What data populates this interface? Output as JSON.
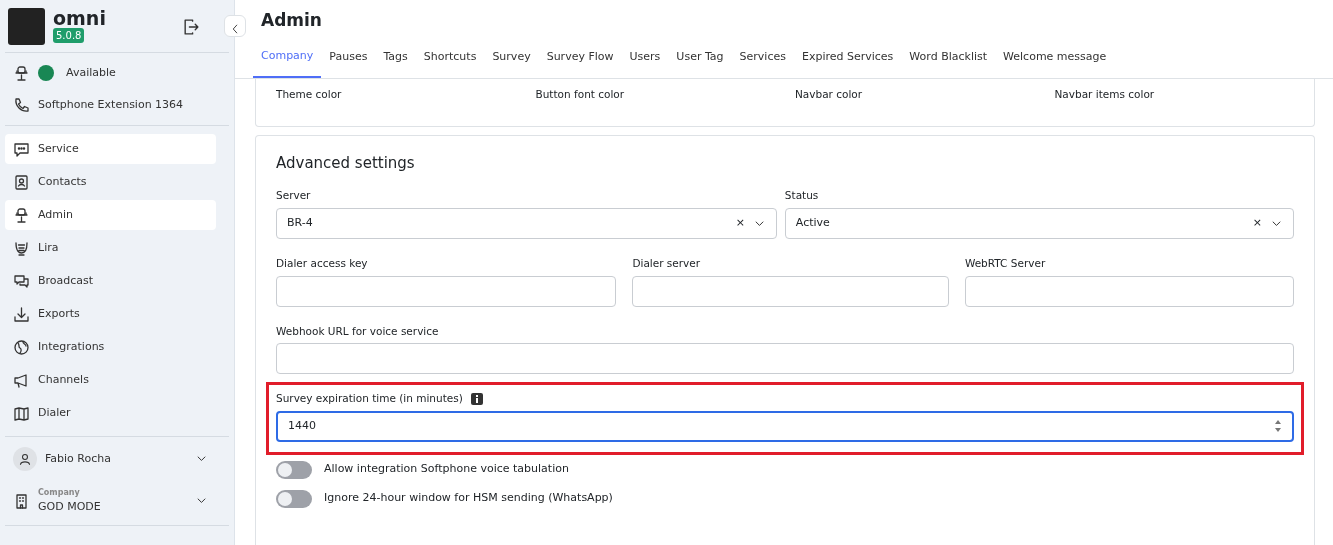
{
  "brand": {
    "name": "omni",
    "version": "5.0.8"
  },
  "status": {
    "label": "Available",
    "color": "#198754"
  },
  "softphone": "Softphone Extension 1364",
  "nav": [
    {
      "label": "Service",
      "selected": true
    },
    {
      "label": "Contacts",
      "selected": false
    },
    {
      "label": "Admin",
      "selected": true
    },
    {
      "label": "Lira",
      "selected": false
    },
    {
      "label": "Broadcast",
      "selected": false
    },
    {
      "label": "Exports",
      "selected": false
    },
    {
      "label": "Integrations",
      "selected": false
    },
    {
      "label": "Channels",
      "selected": false
    },
    {
      "label": "Dialer",
      "selected": false
    }
  ],
  "user": {
    "name": "Fabio Rocha"
  },
  "company": {
    "caption": "Company",
    "name": "GOD MODE"
  },
  "page_title": "Admin",
  "tabs": [
    {
      "label": "Company",
      "selected": true
    },
    {
      "label": "Pauses",
      "selected": false
    },
    {
      "label": "Tags",
      "selected": false
    },
    {
      "label": "Shortcuts",
      "selected": false
    },
    {
      "label": "Survey",
      "selected": false
    },
    {
      "label": "Survey Flow",
      "selected": false
    },
    {
      "label": "Users",
      "selected": false
    },
    {
      "label": "User Tag",
      "selected": false
    },
    {
      "label": "Services",
      "selected": false
    },
    {
      "label": "Expired Services",
      "selected": false
    },
    {
      "label": "Word Blacklist",
      "selected": false
    },
    {
      "label": "Welcome message",
      "selected": false
    }
  ],
  "color_labels": [
    "Theme color",
    "Button font color",
    "Navbar color",
    "Navbar items color"
  ],
  "advanced": {
    "title": "Advanced settings",
    "selects": [
      {
        "label": "Server",
        "value": "BR-4",
        "clear": "×"
      },
      {
        "label": "Status",
        "value": "Active",
        "clear": "×"
      }
    ],
    "inputs": [
      {
        "label": "Dialer access key"
      },
      {
        "label": "Dialer server"
      },
      {
        "label": "WebRTC Server"
      }
    ],
    "webhook": {
      "label": "Webhook URL for voice service"
    },
    "survey_expiration": {
      "label": "Survey expiration time (in minutes)",
      "value": "1440",
      "highlighted": true,
      "focused": true
    },
    "toggles": [
      {
        "label": "Allow integration Softphone voice tabulation",
        "on": false
      },
      {
        "label": "Ignore 24-hour window for HSM sending (WhatsApp)",
        "on": false
      }
    ]
  }
}
